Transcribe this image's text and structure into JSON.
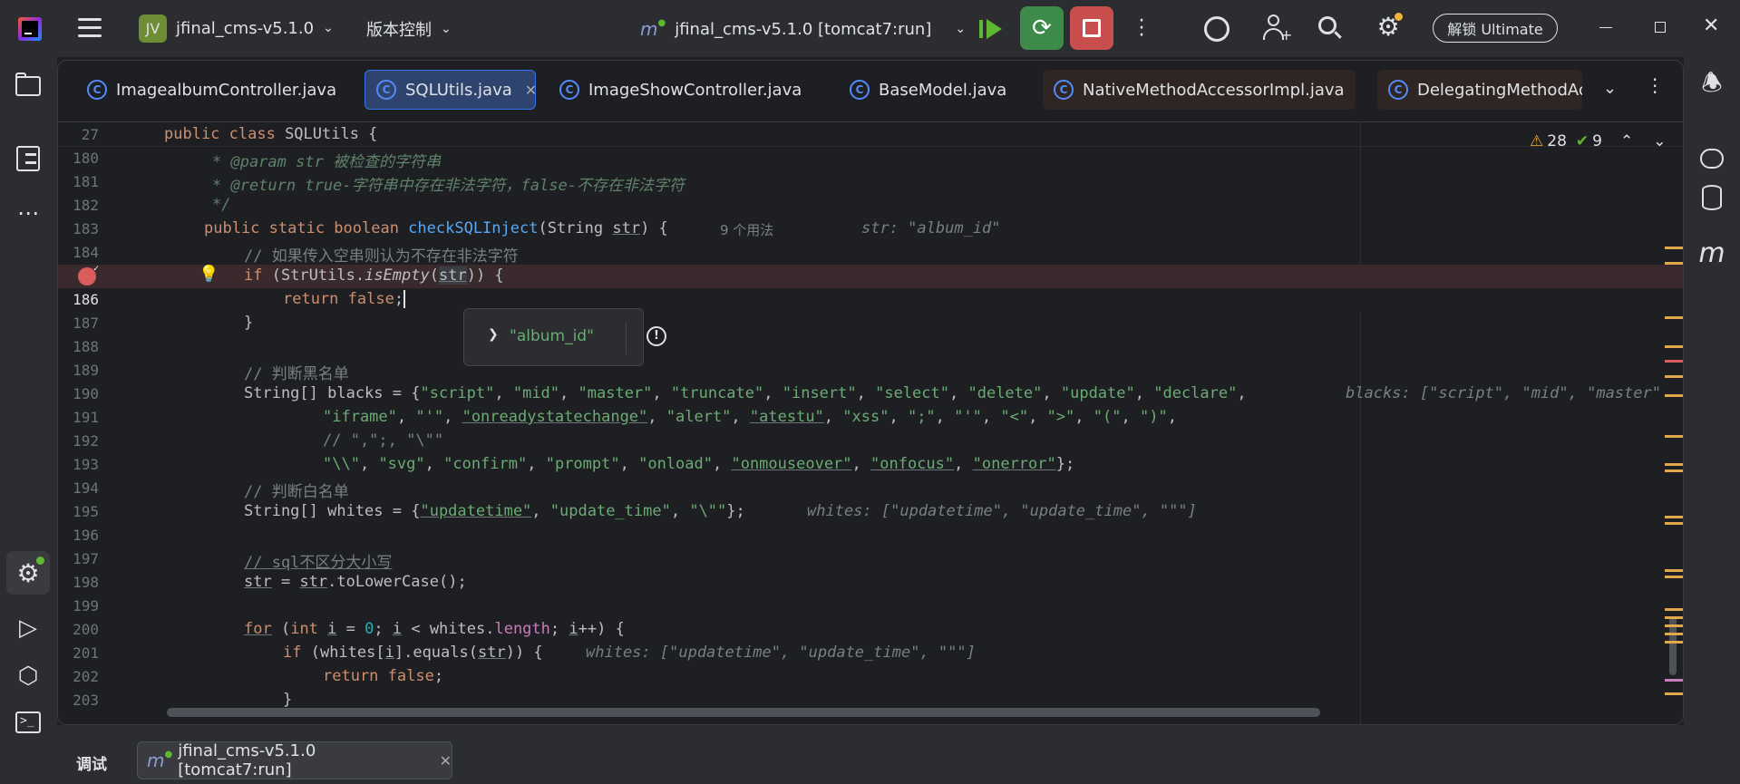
{
  "titlebar": {
    "project_badge": "JV",
    "project_name": "jfinal_cms-v5.1.0",
    "vcs_label": "版本控制",
    "run_config": "jfinal_cms-v5.1.0 [tomcat7:run]",
    "unlock_label": "解锁 Ultimate"
  },
  "tabs": [
    {
      "label": "ImagealbumController.java"
    },
    {
      "label": "SQLUtils.java"
    },
    {
      "label": "ImageShowController.java"
    },
    {
      "label": "BaseModel.java"
    },
    {
      "label": "NativeMethodAccessorImpl.java"
    },
    {
      "label": "DelegatingMethodAc"
    }
  ],
  "inspections": {
    "warnings": "28",
    "ok": "9"
  },
  "sticky_header": {
    "line": "27",
    "code": "public class SQLUtils {"
  },
  "code": {
    "l180": "* @param str 被检查的字符串",
    "l181": "* @return true-字符串中存在非法字符，false-不存在非法字符",
    "l182": "*/",
    "l183_usage": "9 个用法",
    "l183_hint": "str: \"album_id\"",
    "l184": "// 如果传入空串则认为不存在非法字符",
    "l189": "// 判断黑名单",
    "l190_hint": "blacks: [\"script\", \"mid\", \"master\"",
    "l192": "// \",\";, \"\\\"\"",
    "l194": "// 判断白名单",
    "l195_hint": "whites: [\"updatetime\", \"update_time\", \"\"\"]",
    "l197": "// sql不区分大小写",
    "l201_hint": "whites: [\"updatetime\", \"update_time\", \"\"\"]"
  },
  "line_numbers": [
    "180",
    "181",
    "182",
    "183",
    "184",
    "185",
    "186",
    "187",
    "188",
    "189",
    "190",
    "191",
    "192",
    "193",
    "194",
    "195",
    "196",
    "197",
    "198",
    "199",
    "200",
    "201",
    "202",
    "203"
  ],
  "popup": {
    "value": "\"album_id\""
  },
  "bottom": {
    "panel_label": "调试",
    "session": "jfinal_cms-v5.1.0 [tomcat7:run]"
  },
  "colors": {
    "accent_green": "#3e8a4a",
    "stop_red": "#c94f4f",
    "breakpoint_red": "#db5c5c",
    "line_highlight": "#3b2a2d"
  }
}
